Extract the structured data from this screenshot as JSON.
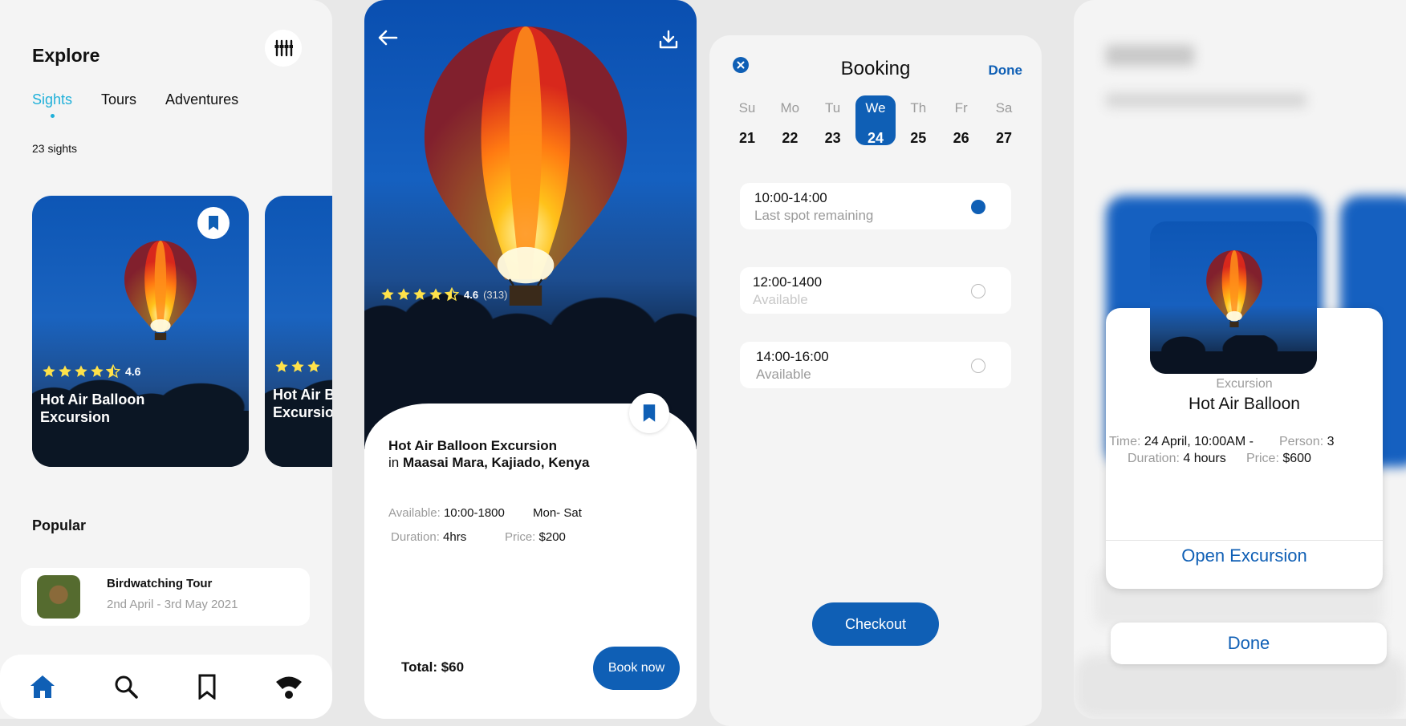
{
  "colors": {
    "accent": "#0f5fb5",
    "tab_active": "#1fb0d9",
    "muted": "#9b9b9b"
  },
  "explore": {
    "title": "Explore",
    "filter_icon": "filter-icon",
    "tabs": [
      {
        "label": "Sights",
        "active": true
      },
      {
        "label": "Tours",
        "active": false
      },
      {
        "label": "Adventures",
        "active": false
      }
    ],
    "count": "23 sights",
    "cards": [
      {
        "name": "Hot Air Balloon Excursion",
        "rating": "4.6"
      },
      {
        "name": "Hot Air Balloon Excursion",
        "rating": ""
      }
    ],
    "popular_heading": "Popular",
    "popular": [
      {
        "title": "Birdwatching Tour",
        "dates": "2nd April - 3rd May 2021"
      }
    ],
    "nav": [
      "home-icon",
      "search-icon",
      "bookmark-icon",
      "wifi-icon"
    ]
  },
  "detail": {
    "rating": "4.6",
    "rating_count": "(313)",
    "title": "Hot Air Balloon Excursion",
    "location_prefix": "in",
    "location": "Maasai Mara, Kajiado, Kenya",
    "available_label": "Available:",
    "available_value": "10:00-1800",
    "days": "Mon- Sat",
    "duration_label": "Duration:",
    "duration_value": "4hrs",
    "price_label": "Price:",
    "price_value": "$200",
    "total": "Total: $60",
    "book_label": "Book now"
  },
  "booking": {
    "title": "Booking",
    "done_label": "Done",
    "days": [
      {
        "name": "Su",
        "date": "21",
        "selected": false
      },
      {
        "name": "Mo",
        "date": "22",
        "selected": false
      },
      {
        "name": "Tu",
        "date": "23",
        "selected": false
      },
      {
        "name": "We",
        "date": "24",
        "selected": true
      },
      {
        "name": "Th",
        "date": "25",
        "selected": false
      },
      {
        "name": "Fr",
        "date": "26",
        "selected": false
      },
      {
        "name": "Sa",
        "date": "27",
        "selected": false
      }
    ],
    "slots": [
      {
        "time": "10:00-14:00",
        "status": "Last spot remaining",
        "selected": true
      },
      {
        "time": "12:00-1400",
        "status": "Available",
        "selected": false
      },
      {
        "time": "14:00-16:00",
        "status": "Available",
        "selected": false
      }
    ],
    "checkout_label": "Checkout"
  },
  "confirm": {
    "type": "Excursion",
    "name": "Hot Air Balloon",
    "time_label": "Time:",
    "time_value": "24 April, 10:00AM -",
    "person_label": "Person:",
    "person_value": "3",
    "duration_label": "Duration:",
    "duration_value": "4 hours",
    "price_label": "Price:",
    "price_value": "$600",
    "open_label": "Open Excursion",
    "done_label": "Done"
  }
}
